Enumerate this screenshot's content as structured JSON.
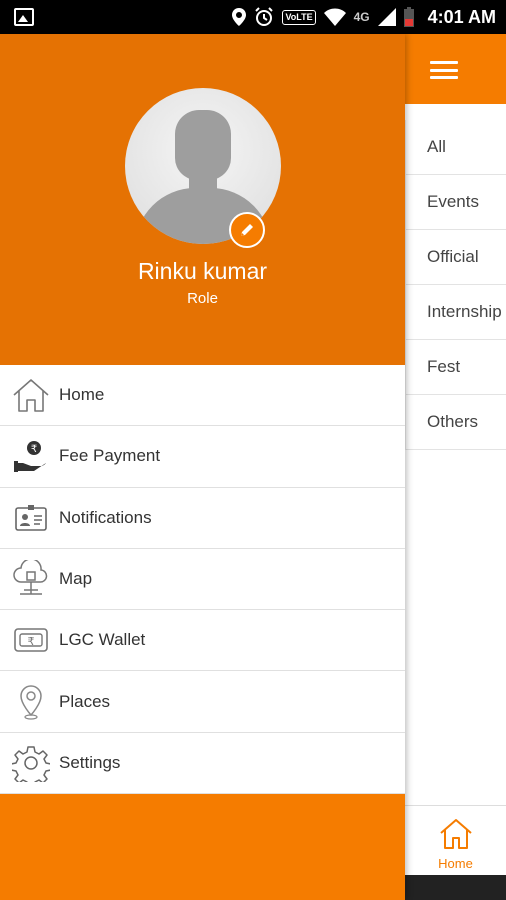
{
  "status_bar": {
    "time": "4:01 AM",
    "network": "4G",
    "volte": "VoLTE",
    "icons": [
      "image-icon",
      "location-icon",
      "alarm-icon",
      "volte-icon",
      "wifi-icon",
      "signal-icon",
      "battery-icon"
    ]
  },
  "drawer": {
    "user": {
      "name": "Rinku kumar",
      "role": "Role"
    },
    "menu": [
      {
        "label": "Home",
        "icon": "home-icon"
      },
      {
        "label": "Fee Payment",
        "icon": "fee-payment-icon"
      },
      {
        "label": "Notifications",
        "icon": "notifications-icon"
      },
      {
        "label": "Map",
        "icon": "map-icon"
      },
      {
        "label": "LGC Wallet",
        "icon": "wallet-icon"
      },
      {
        "label": "Places",
        "icon": "places-icon"
      },
      {
        "label": "Settings",
        "icon": "settings-icon"
      }
    ]
  },
  "background": {
    "categories": [
      "All",
      "Events",
      "Official",
      "Internship",
      "Fest",
      "Others"
    ],
    "bottom_nav": {
      "home_label": "Home"
    }
  },
  "colors": {
    "accent": "#f57c00",
    "header": "#e57203"
  }
}
